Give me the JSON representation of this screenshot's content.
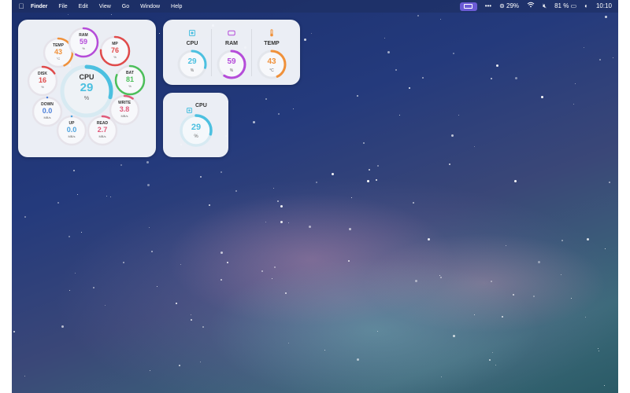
{
  "menubar": {
    "items": [
      "Finder",
      "File",
      "Edit",
      "View",
      "Go",
      "Window",
      "Help"
    ],
    "status": {
      "cpu": "29%",
      "battery": "81 %",
      "time": "10:10"
    }
  },
  "big_widget": {
    "center": {
      "label": "CPU",
      "value": "29",
      "unit": "%",
      "level": 0.29,
      "color": "#4cc0e0"
    },
    "satellites": [
      {
        "id": "ram",
        "label": "RAM",
        "value": "59",
        "unit": "%",
        "level": 0.59,
        "color": "#b54cd9"
      },
      {
        "id": "mp",
        "label": "MP",
        "value": "76",
        "unit": "%",
        "level": 0.76,
        "color": "#e04b4b"
      },
      {
        "id": "bat",
        "label": "BAT",
        "value": "81",
        "unit": "%",
        "level": 0.81,
        "color": "#4cbf5a"
      },
      {
        "id": "write",
        "label": "WRITE",
        "value": "3.8",
        "unit": "MB/s",
        "level": 0.1,
        "color": "#e05a7a"
      },
      {
        "id": "read",
        "label": "READ",
        "value": "2.7",
        "unit": "MB/s",
        "level": 0.08,
        "color": "#e05a7a"
      },
      {
        "id": "up",
        "label": "UP",
        "value": "0.0",
        "unit": "MB/s",
        "level": 0.0,
        "color": "#4aa3df"
      },
      {
        "id": "down",
        "label": "DOWN",
        "value": "0.0",
        "unit": "MB/s",
        "level": 0.0,
        "color": "#4a7ed9"
      },
      {
        "id": "disk",
        "label": "DISK",
        "value": "16",
        "unit": "%",
        "level": 0.16,
        "color": "#e04b4b"
      },
      {
        "id": "temp",
        "label": "TEMP",
        "value": "43",
        "unit": "°C",
        "level": 0.43,
        "color": "#f0913a"
      }
    ]
  },
  "medium_widget": {
    "columns": [
      {
        "id": "cpu",
        "icon": "cpu-chip-icon",
        "label": "CPU",
        "value": "29",
        "unit": "%",
        "level": 0.29,
        "color": "#4cc0e0"
      },
      {
        "id": "ram",
        "icon": "ram-icon",
        "label": "RAM",
        "value": "59",
        "unit": "%",
        "level": 0.59,
        "color": "#b54cd9"
      },
      {
        "id": "temp",
        "icon": "thermometer-icon",
        "label": "TEMP",
        "value": "43",
        "unit": "°C",
        "level": 0.43,
        "color": "#f0913a"
      }
    ]
  },
  "small_widget": {
    "icon": "cpu-chip-icon",
    "label": "CPU",
    "value": "29",
    "unit": "%",
    "level": 0.29,
    "color": "#4cc0e0"
  }
}
